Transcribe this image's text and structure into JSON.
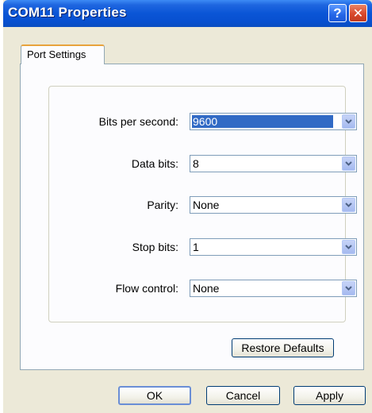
{
  "window": {
    "title": "COM11 Properties"
  },
  "titlebar_buttons": {
    "help_glyph": "?",
    "close_glyph": "✕"
  },
  "tabs": [
    {
      "label": "Port Settings",
      "active": true
    }
  ],
  "fields": {
    "bits_per_second": {
      "label": "Bits per second:",
      "value": "9600",
      "selected": true
    },
    "data_bits": {
      "label": "Data bits:",
      "value": "8"
    },
    "parity": {
      "label": "Parity:",
      "value": "None"
    },
    "stop_bits": {
      "label": "Stop bits:",
      "value": "1"
    },
    "flow_control": {
      "label": "Flow control:",
      "value": "None"
    }
  },
  "buttons": {
    "restore_defaults": "Restore Defaults",
    "ok": "OK",
    "cancel": "Cancel",
    "apply": "Apply"
  },
  "colors": {
    "titlebar": "#0a55d6",
    "selection": "#316ac5",
    "dialog_bg": "#ece9d8",
    "tab_accent": "#e8a33c"
  },
  "icons": {
    "dropdown": "chevron-down-icon",
    "help": "help-icon",
    "close": "close-icon"
  }
}
